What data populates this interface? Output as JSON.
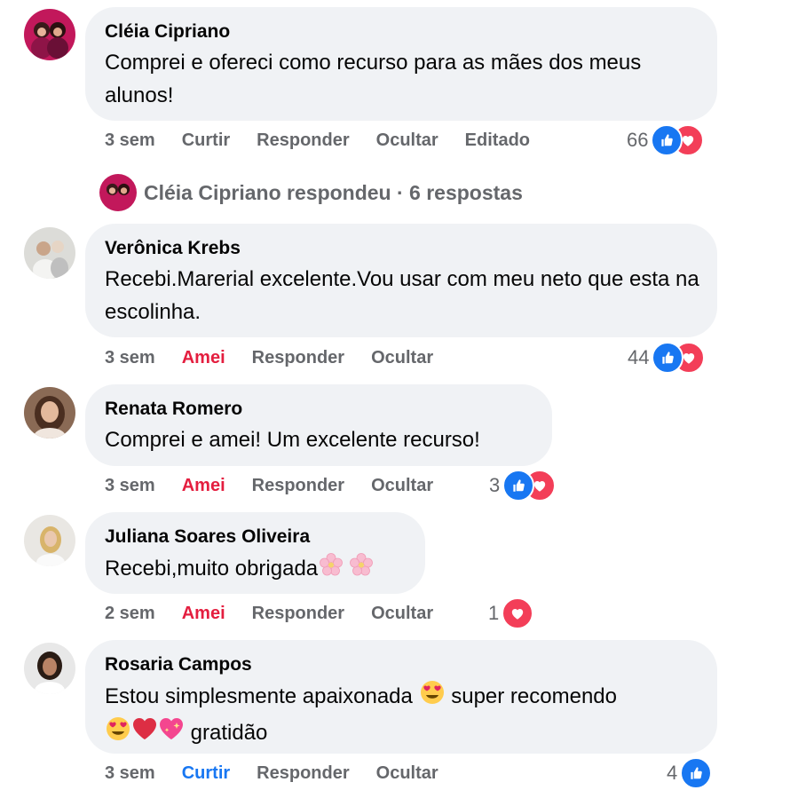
{
  "comments": [
    {
      "author": "Cléia Cipriano",
      "text": "Comprei e ofereci como recurso para as mães dos meus alunos!",
      "time": "3 sem",
      "actions": [
        "Curtir",
        "Responder",
        "Ocultar",
        "Editado"
      ],
      "count": "66",
      "reactions": [
        "like-icon",
        "love-icon"
      ]
    },
    {
      "author": "Verônica Krebs",
      "text": "Recebi.Marerial excelente.Vou usar com meu neto que esta na escolinha.",
      "time": "3 sem",
      "actions": [
        "Amei",
        "Responder",
        "Ocultar"
      ],
      "count": "44",
      "reactions": [
        "like-icon",
        "love-icon"
      ]
    },
    {
      "author": "Renata Romero",
      "text": "Comprei e amei! Um excelente recurso!",
      "time": "3 sem",
      "actions": [
        "Amei",
        "Responder",
        "Ocultar"
      ],
      "count": "3",
      "reactions": [
        "like-icon",
        "love-icon"
      ]
    },
    {
      "author": "Juliana Soares Oliveira",
      "text": "Recebi,muito obrigada",
      "time": "2 sem",
      "actions": [
        "Amei",
        "Responder",
        "Ocultar"
      ],
      "count": "1",
      "reactions": [
        "love-icon"
      ]
    },
    {
      "author": "Rosaria Campos",
      "text_line1": "Estou simplesmente apaixonada",
      "text_line1_after": "super recomendo",
      "text_line2": "gratidão",
      "time": "3 sem",
      "actions": [
        "Curtir",
        "Responder",
        "Ocultar"
      ],
      "count": "4",
      "reactions": [
        "like-icon"
      ]
    }
  ],
  "reply_summary": {
    "label": "Cléia Cipriano respondeu · 6 respostas"
  },
  "colors": {
    "bubble": "#f0f2f5",
    "secondary_text": "#65676b",
    "love_red": "#e41e3f",
    "like_blue": "#1877f2"
  }
}
